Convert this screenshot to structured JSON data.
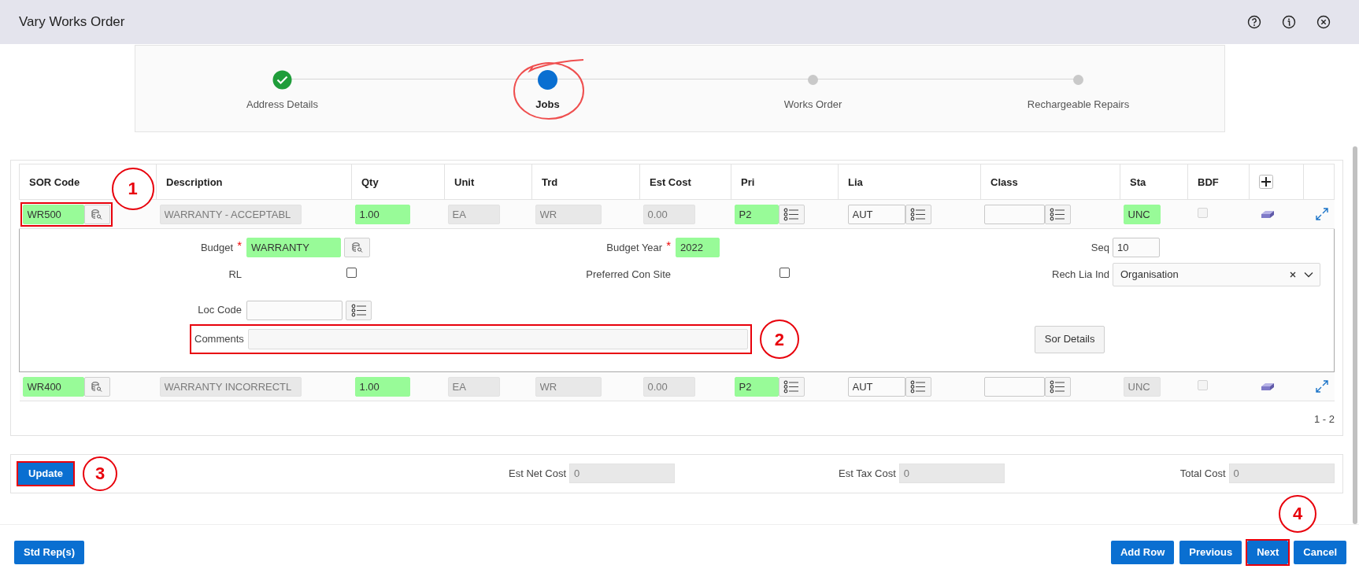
{
  "window": {
    "title": "Vary Works Order"
  },
  "header_icons": [
    {
      "kind": "help"
    },
    {
      "kind": "info"
    },
    {
      "kind": "close"
    }
  ],
  "steps": [
    {
      "label": "Address Details",
      "completed": true,
      "selected": false,
      "circled": false
    },
    {
      "label": "Jobs",
      "completed": false,
      "selected": true,
      "circled": true
    },
    {
      "label": "Works Order",
      "completed": false,
      "selected": false,
      "circled": false
    },
    {
      "label": "Rechargeable Repairs",
      "completed": false,
      "selected": false,
      "circled": false
    }
  ],
  "table": {
    "columns": [
      {
        "label": "SOR Code",
        "kind": "lookup"
      },
      {
        "label": "Description",
        "kind": "text"
      },
      {
        "label": "Qty",
        "kind": "text"
      },
      {
        "label": "Unit",
        "kind": "text"
      },
      {
        "label": "Trd",
        "kind": "text"
      },
      {
        "label": "Est Cost",
        "kind": "text"
      },
      {
        "label": "Pri",
        "kind": "list"
      },
      {
        "label": "Lia",
        "kind": "list"
      },
      {
        "label": "Class",
        "kind": "list"
      },
      {
        "label": "Sta",
        "kind": "text"
      },
      {
        "label": "BDF",
        "kind": "checkbox"
      },
      {
        "kind": "add"
      },
      {
        "kind": "expand"
      }
    ],
    "rows": [
      {
        "cells": [
          {
            "value": "WR500",
            "required": true,
            "readonly": false,
            "highlighted": true,
            "callout": "1"
          },
          {
            "value": "WARRANTY - ACCEPTABL",
            "required": false,
            "readonly": true
          },
          {
            "value": "1.00",
            "required": true,
            "readonly": false
          },
          {
            "value": "EA",
            "required": false,
            "readonly": true
          },
          {
            "value": "WR",
            "required": false,
            "readonly": true
          },
          {
            "value": "0.00",
            "required": false,
            "readonly": true
          },
          {
            "value": "P2",
            "required": true,
            "readonly": false
          },
          {
            "value": "AUT",
            "required": false,
            "readonly": false
          },
          {
            "required": false,
            "readonly": false
          },
          {
            "value": "UNC",
            "required": true,
            "readonly": false
          },
          {
            "checked": false,
            "disabled": true
          }
        ],
        "detail": {
          "budget": {
            "label": "Budget",
            "required_mark": "*",
            "value": "WARRANTY"
          },
          "budget_year": {
            "label": "Budget Year",
            "required_mark": "*",
            "value": "2022"
          },
          "seq": {
            "label": "Seq",
            "value": "10"
          },
          "rl": {
            "label": "RL",
            "checked": false
          },
          "preferred_con_site": {
            "label": "Preferred Con Site",
            "checked": false
          },
          "rech_lia_ind": {
            "label": "Rech Lia Ind",
            "value": "Organisation"
          },
          "loc_code": {
            "label": "Loc Code"
          },
          "comments": {
            "label": "Comments",
            "highlighted": true,
            "callout": "2"
          },
          "sor_details_button": "Sor Details"
        }
      },
      {
        "cells": [
          {
            "value": "WR400",
            "required": true,
            "readonly": false,
            "highlighted": false
          },
          {
            "value": "WARRANTY INCORRECTL",
            "required": false,
            "readonly": true
          },
          {
            "value": "1.00",
            "required": true,
            "readonly": false
          },
          {
            "value": "EA",
            "required": false,
            "readonly": true
          },
          {
            "value": "WR",
            "required": false,
            "readonly": true
          },
          {
            "value": "0.00",
            "required": false,
            "readonly": true
          },
          {
            "value": "P2",
            "required": true,
            "readonly": false
          },
          {
            "value": "AUT",
            "required": false,
            "readonly": false
          },
          {
            "required": false,
            "readonly": false
          },
          {
            "value": "UNC",
            "required": false,
            "readonly": true
          },
          {
            "checked": false,
            "disabled": true
          }
        ]
      }
    ],
    "pagination": "1 - 2"
  },
  "totals": {
    "update_button": {
      "label": "Update",
      "highlighted": true,
      "callout": "3"
    },
    "fields": [
      {
        "label": "Est Net Cost",
        "value": "0"
      },
      {
        "label": "Est Tax Cost",
        "value": "0"
      },
      {
        "label": "Total Cost",
        "value": "0"
      }
    ]
  },
  "footer": {
    "left": [
      {
        "label": "Std Rep(s)",
        "highlighted": false
      }
    ],
    "right": [
      {
        "label": "Add Row",
        "highlighted": false
      },
      {
        "label": "Previous",
        "highlighted": false
      },
      {
        "label": "Next",
        "highlighted": true,
        "callout": "4"
      },
      {
        "label": "Cancel",
        "highlighted": false
      }
    ]
  }
}
